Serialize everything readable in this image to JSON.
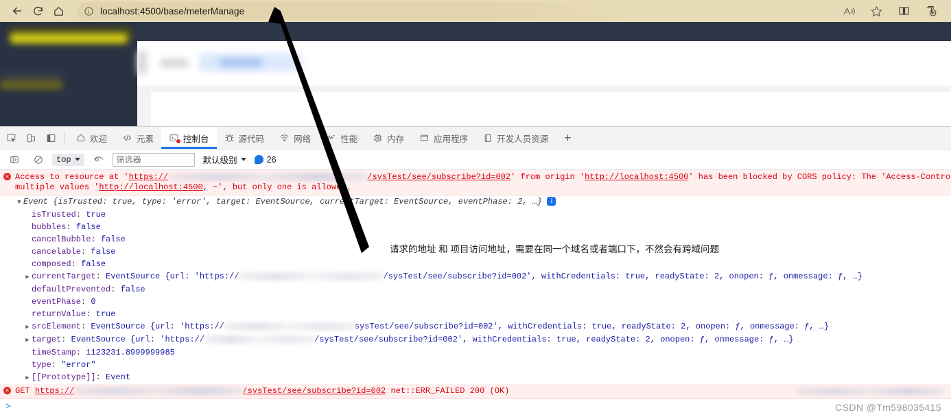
{
  "browser": {
    "url": "localhost:4500/base/meterManage",
    "nav": {
      "back_label": "Back",
      "reload_label": "Refresh",
      "home_label": "Home",
      "site_info_label": "View site information"
    },
    "right_actions": [
      {
        "name": "read-aloud-icon",
        "label": "Read aloud"
      },
      {
        "name": "favorite-star-icon",
        "label": "Add to favorites"
      },
      {
        "name": "split-screen-icon",
        "label": "Split screen"
      },
      {
        "name": "collections-icon",
        "label": "Collections"
      }
    ]
  },
  "devtools": {
    "left_tools": [
      {
        "name": "inspect-element-icon",
        "label": "Inspect"
      },
      {
        "name": "device-toolbar-icon",
        "label": "Toggle device toolbar"
      },
      {
        "name": "dock-side-icon",
        "label": "Dock side"
      }
    ],
    "tabs": [
      {
        "label": "欢迎",
        "icon": "home-icon",
        "active": false
      },
      {
        "label": "元素",
        "icon": "code-brackets-icon",
        "active": false
      },
      {
        "label": "控制台",
        "icon": "console-terminal-icon",
        "active": true,
        "error_badge": true
      },
      {
        "label": "源代码",
        "icon": "bug-icon",
        "active": false
      },
      {
        "label": "网络",
        "icon": "wifi-icon",
        "active": false
      },
      {
        "label": "性能",
        "icon": "pulse-icon",
        "active": false
      },
      {
        "label": "内存",
        "icon": "memory-chip-icon",
        "active": false
      },
      {
        "label": "应用程序",
        "icon": "application-box-icon",
        "active": false
      },
      {
        "label": "开发人员资源",
        "icon": "book-icon",
        "active": false
      }
    ],
    "add_tab_label": "+",
    "toolbar": {
      "sidebar_toggle_label": "Show console sidebar",
      "clear_label": "Clear console",
      "context": "top",
      "eye_label": "Create live expression",
      "filter_placeholder": "筛选器",
      "filter_value": "",
      "levels_label": "默认级别",
      "info_count": "26"
    }
  },
  "console": {
    "cors_error": {
      "line1_a": "Access to resource at '",
      "url_scheme": "https://",
      "url_path": "/sysTest/see/subscribe?id=002",
      "line1_b": "' from origin '",
      "origin": "http://localhost:4500",
      "line1_c": "' has been blocked by CORS policy: The 'Access-Control-Allow-Origin' header contains",
      "line2_a": "multiple values '",
      "line2_origin": "http://localhost:4500",
      "line2_b": ", ~', but only one is allowed."
    },
    "event": {
      "header": "Event {isTrusted: true, type: 'error', target: EventSource, currentTarget: EventSource, eventPhase: 2, …}",
      "props": [
        {
          "expandable": false,
          "name": "isTrusted",
          "value": "true",
          "kind": "bool"
        },
        {
          "expandable": false,
          "name": "bubbles",
          "value": "false",
          "kind": "bool"
        },
        {
          "expandable": false,
          "name": "cancelBubble",
          "value": "false",
          "kind": "bool"
        },
        {
          "expandable": false,
          "name": "cancelable",
          "value": "false",
          "kind": "bool"
        },
        {
          "expandable": false,
          "name": "composed",
          "value": "false",
          "kind": "bool"
        },
        {
          "expandable": true,
          "name": "currentTarget",
          "value": "EventSource {url: 'https://",
          "blur": 210,
          "tail": "/sysTest/see/subscribe?id=002', withCredentials: true, readyState: 2, onopen: ƒ, onmessage: ƒ, …}",
          "kind": "obj"
        },
        {
          "expandable": false,
          "name": "defaultPrevented",
          "value": "false",
          "kind": "bool"
        },
        {
          "expandable": false,
          "name": "eventPhase",
          "value": "0",
          "kind": "num"
        },
        {
          "expandable": false,
          "name": "returnValue",
          "value": "true",
          "kind": "bool"
        },
        {
          "expandable": true,
          "name": "srcElement",
          "value": "EventSource {url: 'https://",
          "blur": 190,
          "tail": "sysTest/see/subscribe?id=002', withCredentials: true, readyState: 2, onopen: ƒ, onmessage: ƒ, …}",
          "kind": "obj"
        },
        {
          "expandable": true,
          "name": "target",
          "value": "EventSource {url: 'https://",
          "blur": 160,
          "tail": "/sysTest/see/subscribe?id=002', withCredentials: true, readyState: 2, onopen: ƒ, onmessage: ƒ, …}",
          "kind": "obj"
        },
        {
          "expandable": false,
          "name": "timeStamp",
          "value": "1123231.8999999985",
          "kind": "num"
        },
        {
          "expandable": false,
          "name": "type",
          "value": "\"error\"",
          "kind": "str"
        },
        {
          "expandable": true,
          "name": "[[Prototype]]",
          "value": "Event",
          "kind": "proto"
        }
      ]
    },
    "get_error": {
      "method": "GET",
      "url_scheme": "https://",
      "url_path": "/sysTest/see/subscribe?id=002",
      "status": "net::ERR_FAILED 200 (OK)"
    },
    "prompt": ">"
  },
  "annotation": "请求的地址 和 项目访问地址，需要在同一个域名或者端口下，不然会有跨域问题",
  "watermark": "CSDN @Tm598035415",
  "colors": {
    "chrome_bg": "#e8dcb8",
    "page_sidebar": "#283243",
    "error_red": "#d8000c",
    "error_bg": "#fff0f0",
    "accent_blue": "#1a73e8",
    "prop_name": "#5c1e91",
    "prop_value": "#1a1aa6"
  }
}
